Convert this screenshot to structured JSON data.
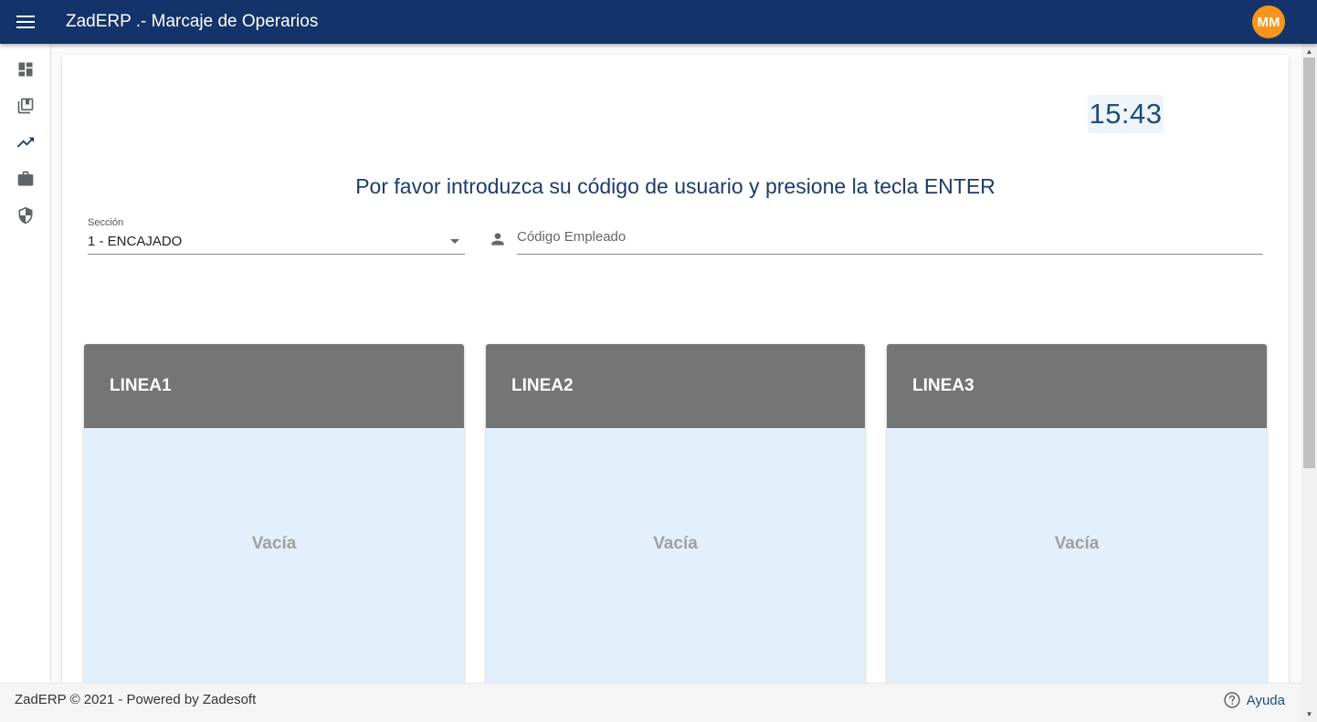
{
  "header": {
    "title": "ZadERP .- Marcaje de Operarios",
    "avatar_initials": "MM",
    "background_color": "#13336a",
    "avatar_color": "#f7941d"
  },
  "sidebar": {
    "items": [
      {
        "icon": "dashboard-icon"
      },
      {
        "icon": "library-icon"
      },
      {
        "icon": "trending-up-icon"
      },
      {
        "icon": "briefcase-icon"
      },
      {
        "icon": "security-shield-icon"
      }
    ]
  },
  "main": {
    "clock": "15:43",
    "prompt": "Por favor introduzca su código de usuario y presione la tecla ENTER",
    "section": {
      "label": "Sección",
      "value": "1 - ENCAJADO"
    },
    "employee_code": {
      "placeholder": "Código Empleado",
      "value": ""
    },
    "lines": [
      {
        "name": "LINEA1",
        "status": "Vacía"
      },
      {
        "name": "LINEA2",
        "status": "Vacía"
      },
      {
        "name": "LINEA3",
        "status": "Vacía"
      }
    ],
    "line_header_color": "#757575",
    "line_body_color": "#e3f0fb"
  },
  "footer": {
    "text": "ZadERP © 2021 - Powered by Zadesoft",
    "help_label": "Ayuda"
  }
}
